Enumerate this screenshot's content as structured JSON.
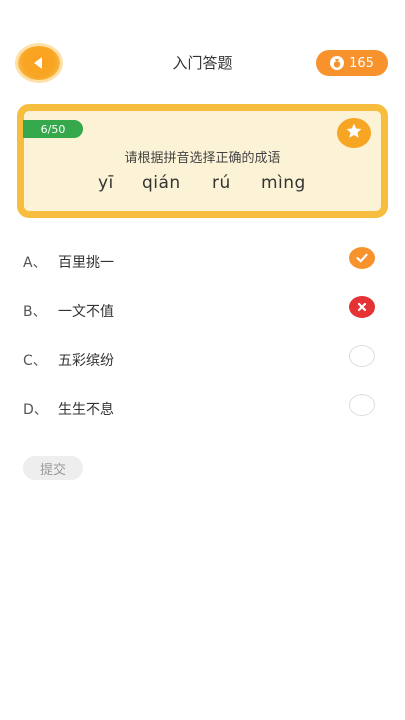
{
  "header": {
    "title": "入门答题",
    "coins": "165",
    "back_icon": "back-arrow-icon",
    "coin_icon": "coin-bag-icon"
  },
  "question_card": {
    "progress": "6/50",
    "prompt": "请根据拼音选择正确的成语",
    "pinyin": [
      "yī",
      "qián",
      "rú",
      "mìng"
    ],
    "favorite_icon": "star-icon"
  },
  "options": [
    {
      "letter": "A、",
      "text": "百里挑一",
      "state": "correct"
    },
    {
      "letter": "B、",
      "text": "一文不值",
      "state": "wrong"
    },
    {
      "letter": "C、",
      "text": "五彩缤纷",
      "state": "unselected"
    },
    {
      "letter": "D、",
      "text": "生生不息",
      "state": "unselected"
    }
  ],
  "submit_label": "提交",
  "colors": {
    "accent_orange": "#f7922c",
    "card_border": "#f7bd3f",
    "card_bg": "#fcf3d6",
    "progress_green": "#34a84b",
    "wrong_red": "#e53235"
  }
}
